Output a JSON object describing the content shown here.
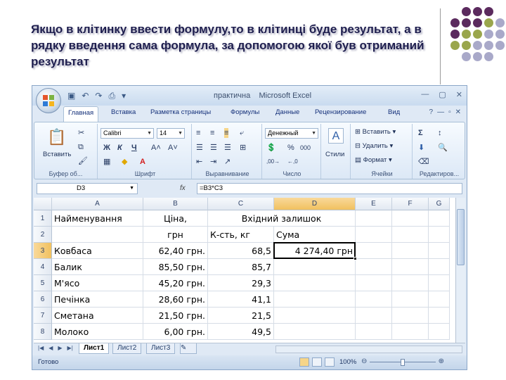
{
  "slide": {
    "title": "Якщо в клітинку ввести формулу,то в клітинці буде результат, а в рядку введення сама формула, за допомогою якої був отриманий результат",
    "dot_colors": [
      "#5b2a5e",
      "#9aa64c",
      "#a9a9c9"
    ]
  },
  "excel": {
    "window_title": "практична    Microsoft Excel",
    "tabs": [
      "Главная",
      "Вставка",
      "Разметка страницы",
      "Формулы",
      "Данные",
      "Рецензирование",
      "Вид"
    ],
    "ribbon": {
      "clipboard": {
        "paste_label": "Вставить",
        "group_label": "Буфер об..."
      },
      "font": {
        "font_name": "Calibri",
        "font_size": "14",
        "bold": "Ж",
        "italic": "К",
        "underline": "Ч",
        "grow": "A˄",
        "shrink": "A˅",
        "group_label": "Шрифт"
      },
      "alignment": {
        "group_label": "Выравнивание"
      },
      "number": {
        "format": "Денежный",
        "percent": "%",
        "thousands": "000",
        "group_label": "Число"
      },
      "styles": {
        "label": "Стили"
      },
      "cells": {
        "insert": "Вставить",
        "delete": "Удалить",
        "format": "Формат",
        "group_label": "Ячейки"
      },
      "editing": {
        "sum": "Σ",
        "group_label": "Редактиров..."
      }
    },
    "name_box": "D3",
    "fx_label": "fx",
    "formula": "=B3*C3",
    "columns": [
      "A",
      "B",
      "C",
      "D",
      "E",
      "F",
      "G"
    ],
    "rows": [
      "1",
      "2",
      "3",
      "4",
      "5",
      "6",
      "7",
      "8"
    ],
    "cells": {
      "A1": "Найменування",
      "B1": "Ціна,",
      "C1": "Вхідний залишок",
      "B2": "грн",
      "C2": "К-сть, кг",
      "D2": "Сума",
      "A3": "Ковбаса",
      "B3": "62,40 грн.",
      "C3": "68,5",
      "D3": "4 274,40 грн",
      "A4": "Балик",
      "B4": "85,50 грн.",
      "C4": "85,7",
      "A5": "М'ясо",
      "B5": "45,20 грн.",
      "C5": "29,3",
      "A6": "Печінка",
      "B6": "28,60 грн.",
      "C6": "41,1",
      "A7": "Сметана",
      "B7": "21,50 грн.",
      "C7": "21,5",
      "A8": "Молоко",
      "B8": "6,00 грн.",
      "C8": "49,5"
    },
    "sheets": [
      "Лист1",
      "Лист2",
      "Лист3"
    ],
    "status": "Готово",
    "zoom": "100%"
  }
}
